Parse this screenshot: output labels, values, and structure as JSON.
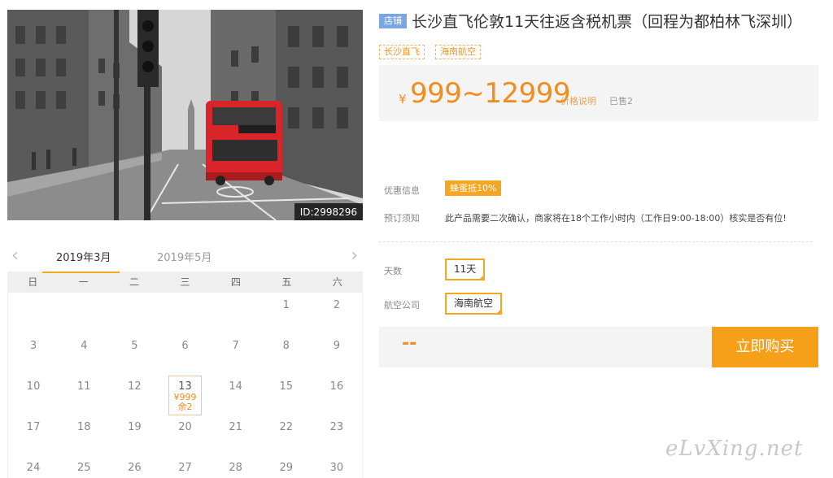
{
  "photo": {
    "id_label": "ID:2998296"
  },
  "product": {
    "shop_badge": "店铺",
    "title": "长沙直飞伦敦11天往返含税机票（回程为都柏林飞深圳）",
    "tags": [
      "长沙直飞",
      "海南航空"
    ],
    "price_symbol": "¥",
    "price_range": "999~12999",
    "price_note": "价格说明",
    "sold": "已售2"
  },
  "coupon": {
    "label": "优惠信息",
    "badge": "蜂蜜抵10%"
  },
  "notice": {
    "label": "预订须知",
    "text": "此产品需要二次确认，商家将在18个工作小时内（工作日9:00-18:00）核实是否有位!"
  },
  "options": {
    "days_label": "天数",
    "days_value": "11天",
    "airline_label": "航空公司",
    "airline_value": "海南航空"
  },
  "buy": {
    "price": "--",
    "button": "立即购买"
  },
  "calendar": {
    "prev_icon": "‹",
    "next_icon": "›",
    "tabs": [
      "2019年3月",
      "2019年5月"
    ],
    "weekdays": [
      "日",
      "一",
      "二",
      "三",
      "四",
      "五",
      "六"
    ],
    "weeks": [
      [
        "",
        "",
        "",
        "",
        "",
        "1",
        "2"
      ],
      [
        "3",
        "4",
        "5",
        "6",
        "7",
        "8",
        "9"
      ],
      [
        "10",
        "11",
        "12",
        "13",
        "14",
        "15",
        "16"
      ],
      [
        "17",
        "18",
        "19",
        "20",
        "21",
        "22",
        "23"
      ],
      [
        "24",
        "25",
        "26",
        "27",
        "28",
        "29",
        "30"
      ]
    ],
    "selected": {
      "day": "13",
      "price": "¥999",
      "remaining": "余2"
    }
  },
  "watermark": "eLvXing.net",
  "colors": {
    "accent": "#f6a623",
    "price": "#f28c1c",
    "badge_blue": "#7aa6e6",
    "bus_red": "#d9252a"
  },
  "icons": {
    "prev": "chevron-left-icon",
    "next": "chevron-right-icon"
  }
}
